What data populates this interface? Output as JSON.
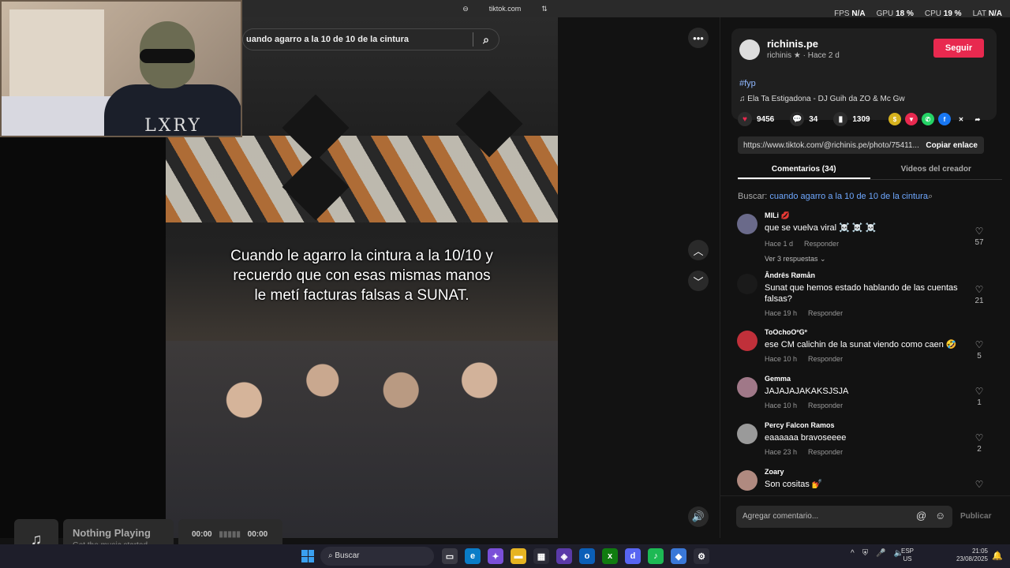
{
  "browser": {
    "url": "tiktok.com",
    "perf": {
      "fps_label": "FPS",
      "fps": "N/A",
      "gpu_label": "GPU",
      "gpu": "18 %",
      "cpu_label": "CPU",
      "cpu": "19 %",
      "lat_label": "LAT",
      "lat": "N/A"
    }
  },
  "webcam": {
    "shirt_text": "LXRY"
  },
  "search": {
    "query": "uando agarro a la 10 de 10 de la cintura"
  },
  "video": {
    "caption_lines": [
      "Cuando le agarro la cintura a la 10/10 y",
      "recuerdo que con esas mismas manos",
      "le metí facturas falsas a SUNAT."
    ]
  },
  "post": {
    "username": "richinis.pe",
    "meta": "richinis ★ · Hace 2 d",
    "follow_label": "Seguir",
    "hashtag": "#fyp",
    "song": "Ela Ta Estigadona - DJ Guih da ZO & Mc Gw",
    "likes": "9456",
    "comments": "34",
    "saves": "1309",
    "link": "https://www.tiktok.com/@richinis.pe/photo/75411...",
    "copy_label": "Copiar enlace"
  },
  "tabs": {
    "comments": "Comentarios (34)",
    "creator_videos": "Videos del creador"
  },
  "comment_search": {
    "prefix": "Buscar:",
    "query": "cuando agarro a la 10 de 10 de la cintura"
  },
  "comments": [
    {
      "name": "MILi 💋",
      "text": "que se vuelva viral ☠️ ☠️ ☠️",
      "time": "Hace 1 d",
      "reply": "Responder",
      "likes": "57",
      "more": "Ver 3 respuestas ⌄",
      "avatar_color": "#6a6a8a"
    },
    {
      "name": "Ândrês Røm‌ån",
      "text": "Sunat que hemos estado hablando de las cuentas falsas?",
      "time": "Hace 19 h",
      "reply": "Responder",
      "likes": "21",
      "avatar_color": "#1a1a1a"
    },
    {
      "name": "ToOchoOºGº",
      "text": "ese CM calichin de la sunat viendo como caen 🤣",
      "time": "Hace 10 h",
      "reply": "Responder",
      "likes": "5",
      "avatar_color": "#c0303a"
    },
    {
      "name": "Gemma",
      "text": "JAJAJAJAKAKSJSJA",
      "time": "Hace 10 h",
      "reply": "Responder",
      "likes": "1",
      "avatar_color": "#a07888"
    },
    {
      "name": "Percy Falcon Ramos",
      "text": "eaaaaaa bravoseeee",
      "time": "Hace 23 h",
      "reply": "Responder",
      "likes": "2",
      "avatar_color": "#9a9a9a"
    },
    {
      "name": "Zoary",
      "text": "Son cositas 💅",
      "time": "",
      "reply": "",
      "likes": "",
      "avatar_color": "#b08a80"
    }
  ],
  "add_comment": {
    "placeholder": "Agregar comentario...",
    "publish": "Publicar"
  },
  "music": {
    "title": "Nothing Playing",
    "subtitle": "Get the music started",
    "time_start": "00:00",
    "time_end": "00:00"
  },
  "taskbar": {
    "search": "Buscar",
    "lang_top": "ESP",
    "lang_bottom": "US",
    "time": "21:05",
    "date": "23/08/2025"
  }
}
